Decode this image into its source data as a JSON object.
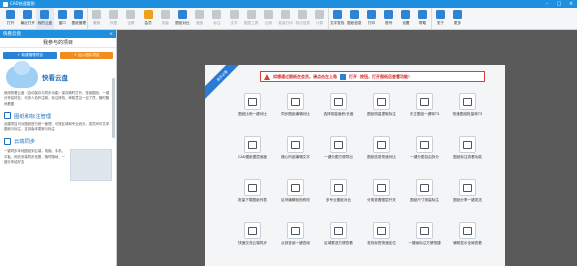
{
  "window": {
    "title": "CAD快速看图"
  },
  "toolbar": {
    "items": [
      {
        "label": "打开",
        "icon": "open-icon",
        "enabled": true
      },
      {
        "label": "最近打开",
        "icon": "recent-icon",
        "enabled": true
      },
      {
        "label": "我的云盘",
        "icon": "cloud-icon",
        "enabled": true,
        "active": true
      },
      {
        "label": "窗口",
        "icon": "window-icon",
        "enabled": true
      },
      {
        "label": "图纸管理",
        "icon": "drawing-manage-icon",
        "enabled": true
      },
      {
        "label": "撤销",
        "icon": "undo-icon",
        "enabled": false
      },
      {
        "label": "恢复",
        "icon": "redo-icon",
        "enabled": false
      },
      {
        "label": "全屏",
        "icon": "fullscreen-icon",
        "enabled": false
      },
      {
        "label": "会员",
        "icon": "vip-icon",
        "enabled": true,
        "accent": true
      },
      {
        "label": "测量",
        "icon": "measure-icon",
        "enabled": false
      },
      {
        "label": "图纸对比",
        "icon": "compare-icon",
        "enabled": true
      },
      {
        "label": "缩放",
        "icon": "zoom-icon",
        "enabled": false
      },
      {
        "label": "标注",
        "icon": "annotate-icon",
        "enabled": false
      },
      {
        "label": "文字",
        "icon": "text-icon",
        "enabled": false
      },
      {
        "label": "图层工具",
        "icon": "layer-icon",
        "enabled": false
      },
      {
        "label": "比例",
        "icon": "scale-icon",
        "enabled": false
      },
      {
        "label": "批量打印",
        "icon": "batch-print-icon",
        "enabled": false
      },
      {
        "label": "标注信息",
        "icon": "annotation-info-icon",
        "enabled": false
      },
      {
        "label": "计算",
        "icon": "calc-icon",
        "enabled": false
      },
      {
        "label": "文字查找",
        "icon": "find-text-icon",
        "enabled": true
      },
      {
        "label": "图纸信息",
        "icon": "drawing-info-icon",
        "enabled": true
      },
      {
        "label": "打印",
        "icon": "print-icon",
        "enabled": true
      },
      {
        "label": "账号",
        "icon": "account-icon",
        "enabled": true
      },
      {
        "label": "设置",
        "icon": "settings-icon",
        "enabled": true
      },
      {
        "label": "帮助",
        "icon": "help-icon",
        "enabled": true
      },
      {
        "label": "关于",
        "icon": "about-icon",
        "enabled": true
      },
      {
        "label": "更多",
        "icon": "more-icon",
        "enabled": true
      }
    ]
  },
  "sidebar": {
    "header": "快看云盘",
    "close": "×",
    "subtitle": "我参与的项目",
    "btn_new": "+ 新建管理项目",
    "btn_join": "+ 加入团队项目",
    "cloud_title": "快看云盘",
    "intro": "使用快看云盘（自动保存与同步功能）保存随时打开、查阅图纸，一键分享给好友，可多人协作注释、标注修改、审核意见一目了然，随时随地看图",
    "section1": "图纸和标注管理",
    "section1_text": "创建项目可对图纸进行统一管理，可按区域和专业划分，成员间可共享图纸与标注，支持版本更新与标注",
    "section2": "云端同步",
    "section2_text": "一键同步本地图纸到云端，电脑、手机、平板、网页多端同步查看，随时随地，一键分享给好友"
  },
  "notice": {
    "text1": "如想通过图纸在会员，请点击左上角",
    "text2": "打开",
    "text3": "按钮，打开图纸后查看功能！",
    "corner": "新手必看"
  },
  "features": [
    "图纸比例一键对比",
    "同步图纸编辑对比",
    "选择测量面积/长度",
    "图纸测量提取标注",
    "天正图纸一键转T3",
    "快速图纸批量转T3",
    "CAD图纸图层面板",
    "随心所欲编辑文字",
    "一键分图方便导出",
    "图纸信息快速对比",
    "一键分图自由拆分",
    "图纸标注查看功能",
    "批量下载图纸列表",
    "区块编辑轻松修改",
    "多专业图纸对比",
    "分类查看图层开关",
    "图纸尺寸测量标注",
    "图纸分享一键发送",
    "快速交流云端同步",
    "点到查阅一键查阅",
    "区域框选方便查看",
    "查找标签快速定位",
    "一键画标注方便快捷",
    "辅助显示全局查看"
  ]
}
